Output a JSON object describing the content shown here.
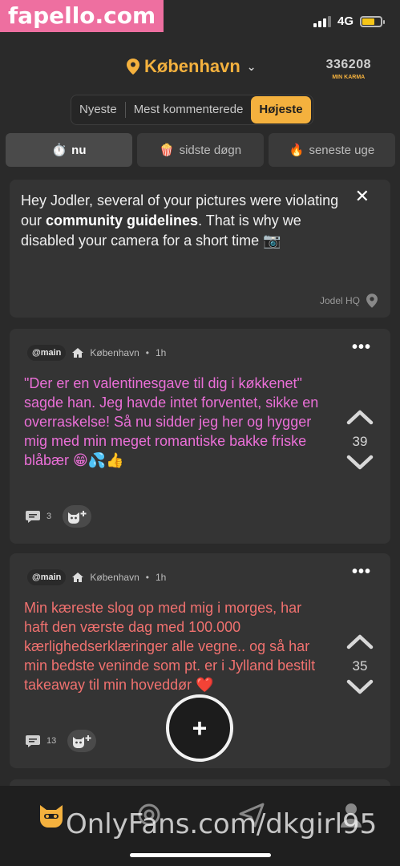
{
  "watermark_top": "fapello.com",
  "status": {
    "network": "4G",
    "battery_level": 0.7
  },
  "header": {
    "location": "København",
    "karma_value": "336208",
    "karma_label": "MIN KARMA"
  },
  "sort_tabs": [
    {
      "label": "Nyeste",
      "active": false
    },
    {
      "label": "Mest kommenterede",
      "active": false
    },
    {
      "label": "Højeste",
      "active": true
    }
  ],
  "time_filters": [
    {
      "emoji": "⏱️",
      "label": "nu",
      "active": true
    },
    {
      "emoji": "🍿",
      "label": "sidste døgn",
      "active": false
    },
    {
      "emoji": "🔥",
      "label": "seneste uge",
      "active": false
    }
  ],
  "notice": {
    "text_before": "Hey Jodler, several of your pictures were violating our ",
    "text_bold": "community guidelines",
    "text_after": ". That is why we disabled your camera for a short time 📷",
    "from": "Jodel HQ"
  },
  "posts": [
    {
      "tag": "@main",
      "location": "København",
      "time": "1h",
      "text": "\"Der er en valentinesgave til dig i køkkenet\" sagde han. Jeg havde intet forventet, sikke en overraskelse! Så nu sidder jeg her og hygger mig med min meget romantiske bakke friske blåbær 😁💦👍",
      "votes": "39",
      "comments": "3",
      "color": "#ea6fd7"
    },
    {
      "tag": "@main",
      "location": "København",
      "time": "1h",
      "text": "Min kæreste slog op med mig i morges, har haft den værste dag med 100.000 kærlighedserklæringer alle vegne.. og så har min bedste veninde som pt. er i Jylland  bestilt takeaway til min hoveddør ❤️",
      "votes": "35",
      "comments": "13",
      "color": "#f0716f"
    }
  ],
  "fab_label": "+",
  "watermark_bottom": "OnlyFans.com/dkgirl95",
  "colors": {
    "accent": "#f4b13e",
    "background": "#2a2a2a",
    "card": "#343434"
  }
}
